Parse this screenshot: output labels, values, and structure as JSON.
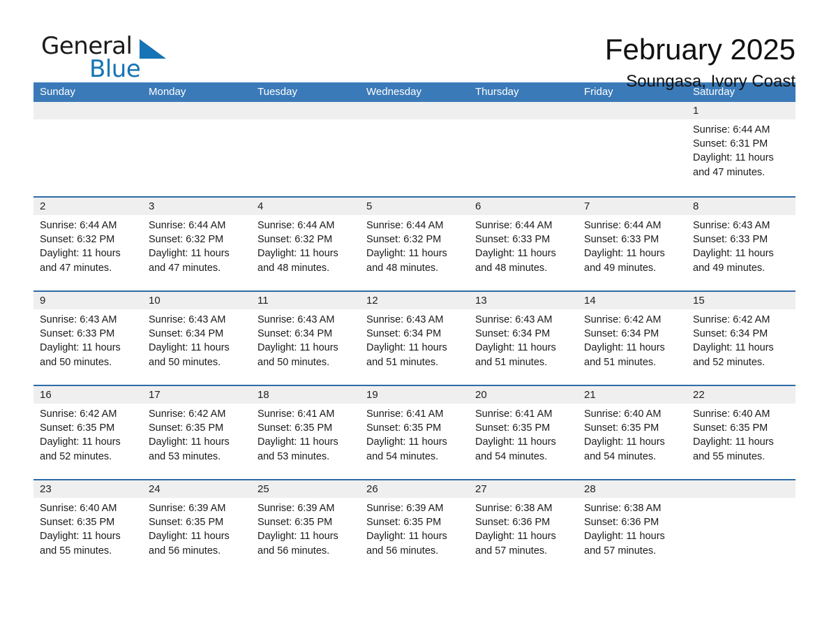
{
  "brand": {
    "name_dark": "General",
    "name_light": "Blue",
    "triangle_color": "#1574b5"
  },
  "header": {
    "month_title": "February 2025",
    "location": "Soungasa, Ivory Coast"
  },
  "colors": {
    "header_blue": "#3b7ab8",
    "row_rule_blue": "#2d6ca8",
    "daynum_band": "#efefef",
    "text": "#1a1a1a"
  },
  "calendar": {
    "weekday_headers": [
      "Sunday",
      "Monday",
      "Tuesday",
      "Wednesday",
      "Thursday",
      "Friday",
      "Saturday"
    ],
    "weeks": [
      [
        {
          "day": "",
          "empty": true
        },
        {
          "day": "",
          "empty": true
        },
        {
          "day": "",
          "empty": true
        },
        {
          "day": "",
          "empty": true
        },
        {
          "day": "",
          "empty": true
        },
        {
          "day": "",
          "empty": true
        },
        {
          "day": "1",
          "sunrise": "Sunrise: 6:44 AM",
          "sunset": "Sunset: 6:31 PM",
          "daylight": "Daylight: 11 hours and 47 minutes."
        }
      ],
      [
        {
          "day": "2",
          "sunrise": "Sunrise: 6:44 AM",
          "sunset": "Sunset: 6:32 PM",
          "daylight": "Daylight: 11 hours and 47 minutes."
        },
        {
          "day": "3",
          "sunrise": "Sunrise: 6:44 AM",
          "sunset": "Sunset: 6:32 PM",
          "daylight": "Daylight: 11 hours and 47 minutes."
        },
        {
          "day": "4",
          "sunrise": "Sunrise: 6:44 AM",
          "sunset": "Sunset: 6:32 PM",
          "daylight": "Daylight: 11 hours and 48 minutes."
        },
        {
          "day": "5",
          "sunrise": "Sunrise: 6:44 AM",
          "sunset": "Sunset: 6:32 PM",
          "daylight": "Daylight: 11 hours and 48 minutes."
        },
        {
          "day": "6",
          "sunrise": "Sunrise: 6:44 AM",
          "sunset": "Sunset: 6:33 PM",
          "daylight": "Daylight: 11 hours and 48 minutes."
        },
        {
          "day": "7",
          "sunrise": "Sunrise: 6:44 AM",
          "sunset": "Sunset: 6:33 PM",
          "daylight": "Daylight: 11 hours and 49 minutes."
        },
        {
          "day": "8",
          "sunrise": "Sunrise: 6:43 AM",
          "sunset": "Sunset: 6:33 PM",
          "daylight": "Daylight: 11 hours and 49 minutes."
        }
      ],
      [
        {
          "day": "9",
          "sunrise": "Sunrise: 6:43 AM",
          "sunset": "Sunset: 6:33 PM",
          "daylight": "Daylight: 11 hours and 50 minutes."
        },
        {
          "day": "10",
          "sunrise": "Sunrise: 6:43 AM",
          "sunset": "Sunset: 6:34 PM",
          "daylight": "Daylight: 11 hours and 50 minutes."
        },
        {
          "day": "11",
          "sunrise": "Sunrise: 6:43 AM",
          "sunset": "Sunset: 6:34 PM",
          "daylight": "Daylight: 11 hours and 50 minutes."
        },
        {
          "day": "12",
          "sunrise": "Sunrise: 6:43 AM",
          "sunset": "Sunset: 6:34 PM",
          "daylight": "Daylight: 11 hours and 51 minutes."
        },
        {
          "day": "13",
          "sunrise": "Sunrise: 6:43 AM",
          "sunset": "Sunset: 6:34 PM",
          "daylight": "Daylight: 11 hours and 51 minutes."
        },
        {
          "day": "14",
          "sunrise": "Sunrise: 6:42 AM",
          "sunset": "Sunset: 6:34 PM",
          "daylight": "Daylight: 11 hours and 51 minutes."
        },
        {
          "day": "15",
          "sunrise": "Sunrise: 6:42 AM",
          "sunset": "Sunset: 6:34 PM",
          "daylight": "Daylight: 11 hours and 52 minutes."
        }
      ],
      [
        {
          "day": "16",
          "sunrise": "Sunrise: 6:42 AM",
          "sunset": "Sunset: 6:35 PM",
          "daylight": "Daylight: 11 hours and 52 minutes."
        },
        {
          "day": "17",
          "sunrise": "Sunrise: 6:42 AM",
          "sunset": "Sunset: 6:35 PM",
          "daylight": "Daylight: 11 hours and 53 minutes."
        },
        {
          "day": "18",
          "sunrise": "Sunrise: 6:41 AM",
          "sunset": "Sunset: 6:35 PM",
          "daylight": "Daylight: 11 hours and 53 minutes."
        },
        {
          "day": "19",
          "sunrise": "Sunrise: 6:41 AM",
          "sunset": "Sunset: 6:35 PM",
          "daylight": "Daylight: 11 hours and 54 minutes."
        },
        {
          "day": "20",
          "sunrise": "Sunrise: 6:41 AM",
          "sunset": "Sunset: 6:35 PM",
          "daylight": "Daylight: 11 hours and 54 minutes."
        },
        {
          "day": "21",
          "sunrise": "Sunrise: 6:40 AM",
          "sunset": "Sunset: 6:35 PM",
          "daylight": "Daylight: 11 hours and 54 minutes."
        },
        {
          "day": "22",
          "sunrise": "Sunrise: 6:40 AM",
          "sunset": "Sunset: 6:35 PM",
          "daylight": "Daylight: 11 hours and 55 minutes."
        }
      ],
      [
        {
          "day": "23",
          "sunrise": "Sunrise: 6:40 AM",
          "sunset": "Sunset: 6:35 PM",
          "daylight": "Daylight: 11 hours and 55 minutes."
        },
        {
          "day": "24",
          "sunrise": "Sunrise: 6:39 AM",
          "sunset": "Sunset: 6:35 PM",
          "daylight": "Daylight: 11 hours and 56 minutes."
        },
        {
          "day": "25",
          "sunrise": "Sunrise: 6:39 AM",
          "sunset": "Sunset: 6:35 PM",
          "daylight": "Daylight: 11 hours and 56 minutes."
        },
        {
          "day": "26",
          "sunrise": "Sunrise: 6:39 AM",
          "sunset": "Sunset: 6:35 PM",
          "daylight": "Daylight: 11 hours and 56 minutes."
        },
        {
          "day": "27",
          "sunrise": "Sunrise: 6:38 AM",
          "sunset": "Sunset: 6:36 PM",
          "daylight": "Daylight: 11 hours and 57 minutes."
        },
        {
          "day": "28",
          "sunrise": "Sunrise: 6:38 AM",
          "sunset": "Sunset: 6:36 PM",
          "daylight": "Daylight: 11 hours and 57 minutes."
        },
        {
          "day": "",
          "empty": true
        }
      ]
    ]
  }
}
